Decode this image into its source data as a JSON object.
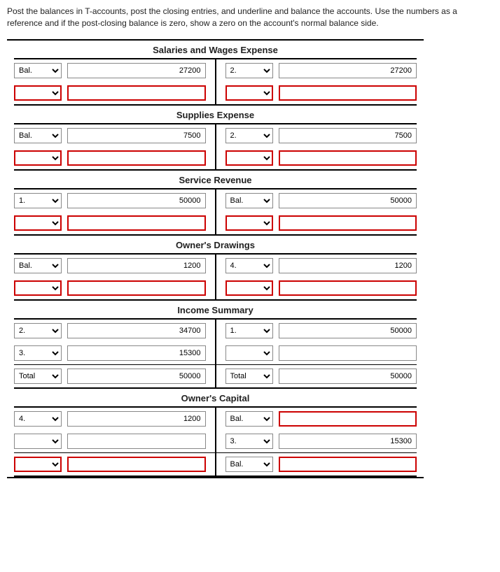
{
  "instructions": "Post the balances in T-accounts, post the closing entries, and underline and balance the accounts. Use the numbers as a reference and if the post-closing balance is zero, show a zero on the account's normal balance side.",
  "accounts": [
    {
      "title": "Salaries and Wages Expense",
      "rows": [
        {
          "left_ref": "Bal.",
          "left_amt": "27200",
          "right_ref": "2.",
          "right_amt": "27200",
          "left_red": false,
          "right_red": false
        },
        {
          "left_ref": "",
          "left_amt": "",
          "right_ref": "",
          "right_amt": "",
          "left_red": true,
          "right_red": true
        }
      ]
    },
    {
      "title": "Supplies Expense",
      "rows": [
        {
          "left_ref": "Bal.",
          "left_amt": "7500",
          "right_ref": "2.",
          "right_amt": "7500",
          "left_red": false,
          "right_red": false
        },
        {
          "left_ref": "",
          "left_amt": "",
          "right_ref": "",
          "right_amt": "",
          "left_red": true,
          "right_red": true
        }
      ]
    },
    {
      "title": "Service Revenue",
      "rows": [
        {
          "left_ref": "1.",
          "left_amt": "50000",
          "right_ref": "Bal.",
          "right_amt": "50000",
          "left_red": false,
          "right_red": false
        },
        {
          "left_ref": "",
          "left_amt": "",
          "right_ref": "",
          "right_amt": "",
          "left_red": true,
          "right_red": true
        }
      ]
    },
    {
      "title": "Owner's Drawings",
      "rows": [
        {
          "left_ref": "Bal.",
          "left_amt": "1200",
          "right_ref": "4.",
          "right_amt": "1200",
          "left_red": false,
          "right_red": false
        },
        {
          "left_ref": "",
          "left_amt": "",
          "right_ref": "",
          "right_amt": "",
          "left_red": true,
          "right_red": true
        }
      ]
    },
    {
      "title": "Income Summary",
      "rows": [
        {
          "left_ref": "2.",
          "left_amt": "34700",
          "right_ref": "1.",
          "right_amt": "50000",
          "left_red": false,
          "right_red": false
        },
        {
          "left_ref": "3.",
          "left_amt": "15300",
          "right_ref": "",
          "right_amt": "",
          "left_red": false,
          "right_red": false,
          "rule_after": "thin"
        },
        {
          "left_ref": "Total",
          "left_amt": "50000",
          "right_ref": "Total",
          "right_amt": "50000",
          "left_red": false,
          "right_red": false
        }
      ]
    },
    {
      "title": "Owner's Capital",
      "rows": [
        {
          "left_ref": "4.",
          "left_amt": "1200",
          "right_ref": "Bal.",
          "right_amt": "",
          "left_red": false,
          "right_red": true
        },
        {
          "left_ref": "",
          "left_amt": "",
          "right_ref": "3.",
          "right_amt": "15300",
          "left_red": false,
          "right_red": false,
          "rule_after": "thin"
        },
        {
          "left_ref": "",
          "left_amt": "",
          "right_ref": "Bal.",
          "right_amt": "",
          "left_red": true,
          "right_red": true
        }
      ]
    }
  ]
}
